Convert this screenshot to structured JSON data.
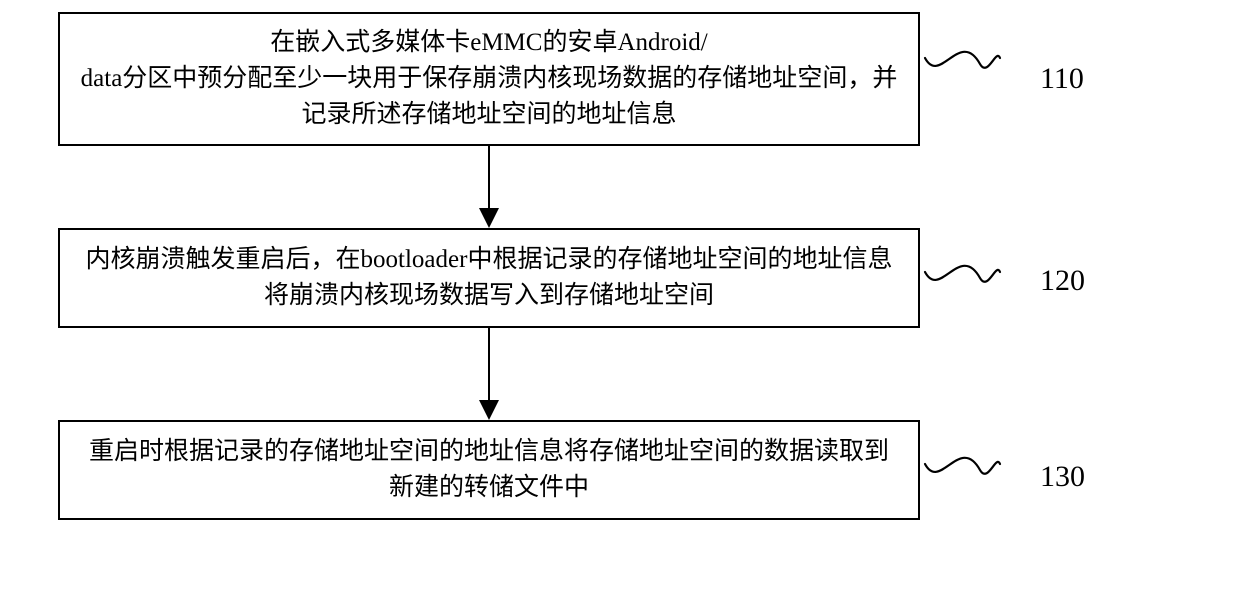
{
  "diagram": {
    "boxes": [
      {
        "id": "step1",
        "text": "在嵌入式多媒体卡eMMC的安卓Android/\ndata分区中预分配至少一块用于保存崩溃内核现场数据的存储地址空间，并记录所述存储地址空间的地址信息",
        "label": "110"
      },
      {
        "id": "step2",
        "text": "内核崩溃触发重启后，在bootloader中根据记录的存储地址空间的地址信息将崩溃内核现场数据写入到存储地址空间",
        "label": "120"
      },
      {
        "id": "step3",
        "text": "重启时根据记录的存储地址空间的地址信息将存储地址空间的数据读取到新建的转储文件中",
        "label": "130"
      }
    ]
  }
}
